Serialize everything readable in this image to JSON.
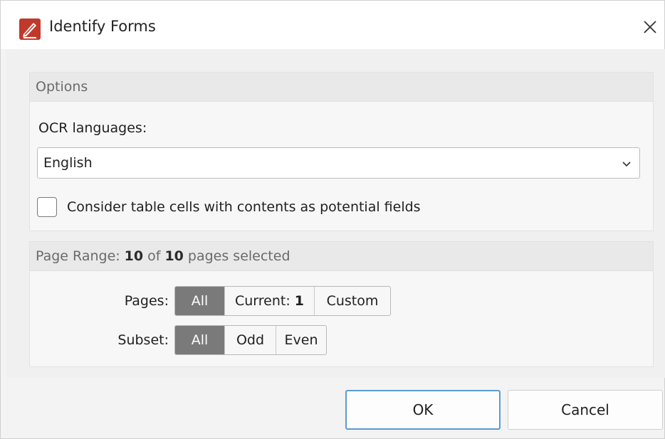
{
  "window": {
    "title": "Identify Forms",
    "close_glyph": "✕"
  },
  "options": {
    "header": "Options",
    "ocr_label": "OCR languages:",
    "ocr_value": "English",
    "checkbox_label": "Consider table cells with contents as potential fields",
    "checkbox_checked": false
  },
  "page_range": {
    "header_prefix": "Page Range:",
    "selected_count": "10",
    "of_text": "of",
    "total_count": "10",
    "suffix": "pages selected",
    "pages_label": "Pages:",
    "pages_options": [
      "All",
      "Current:",
      "1",
      "Custom"
    ],
    "pages_selected": "All",
    "subset_label": "Subset:",
    "subset_options": [
      "All",
      "Odd",
      "Even"
    ],
    "subset_selected": "All"
  },
  "buttons": {
    "ok": "OK",
    "cancel": "Cancel"
  },
  "icons": {
    "app": "pdf-edit-app-icon",
    "close": "close-icon",
    "dropdown": "chevron-down-icon"
  },
  "colors": {
    "accent_border": "#5a9bd5",
    "segment_active": "#7a7a7a",
    "app_icon_red": "#c0392b"
  }
}
